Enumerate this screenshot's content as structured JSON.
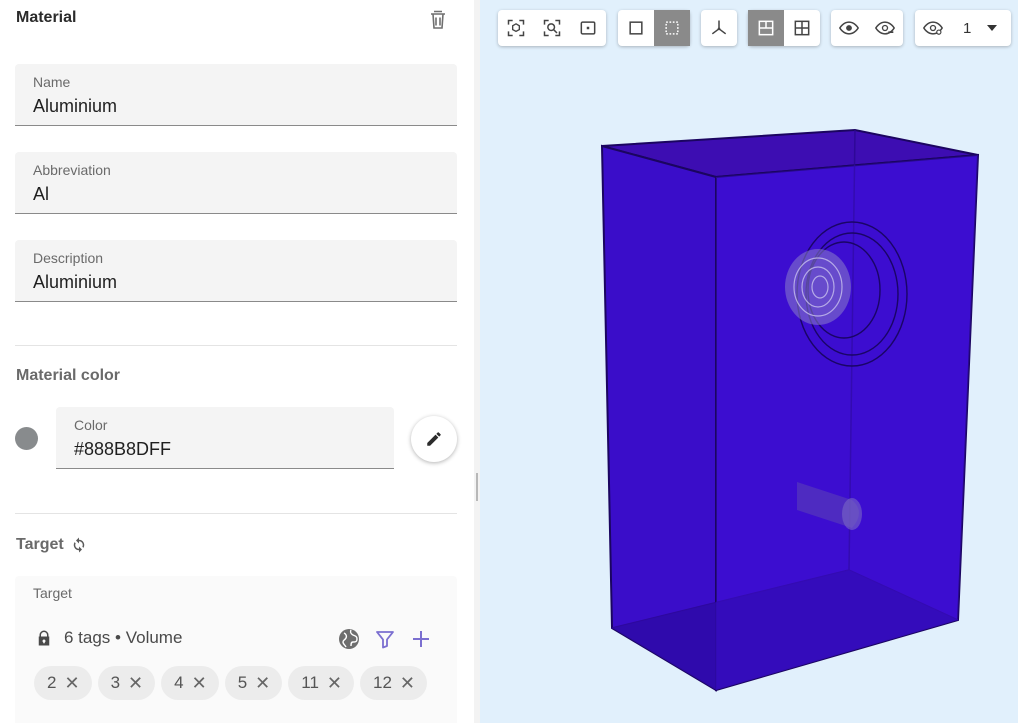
{
  "panel": {
    "title": "Material"
  },
  "fields": {
    "name": {
      "label": "Name",
      "value": "Aluminium"
    },
    "abbreviation": {
      "label": "Abbreviation",
      "value": "Al"
    },
    "description": {
      "label": "Description",
      "value": "Aluminium"
    }
  },
  "material_color": {
    "section_title": "Material color",
    "color_label": "Color",
    "color_value": "#888B8DFF",
    "swatch_color": "#888B8D"
  },
  "target": {
    "section_title": "Target",
    "box_label": "Target",
    "summary": "6 tags • Volume",
    "tags": [
      "2",
      "3",
      "4",
      "5",
      "11",
      "12"
    ]
  },
  "viewport": {
    "background": "#e1f0fc",
    "model_color": "#3a0ccf",
    "layer_value": "1",
    "toolbar_icons": [
      "fit-all-icon",
      "zoom-to-icon",
      "frame-icon",
      "box-select-icon",
      "dotted-select-icon",
      "axes-icon",
      "split-view-icon",
      "quad-view-icon",
      "show-icon",
      "hide-icon",
      "visibility-layer-icon"
    ]
  },
  "colors": {
    "accent": "#7b6fd0",
    "icon_gray": "#555555"
  }
}
